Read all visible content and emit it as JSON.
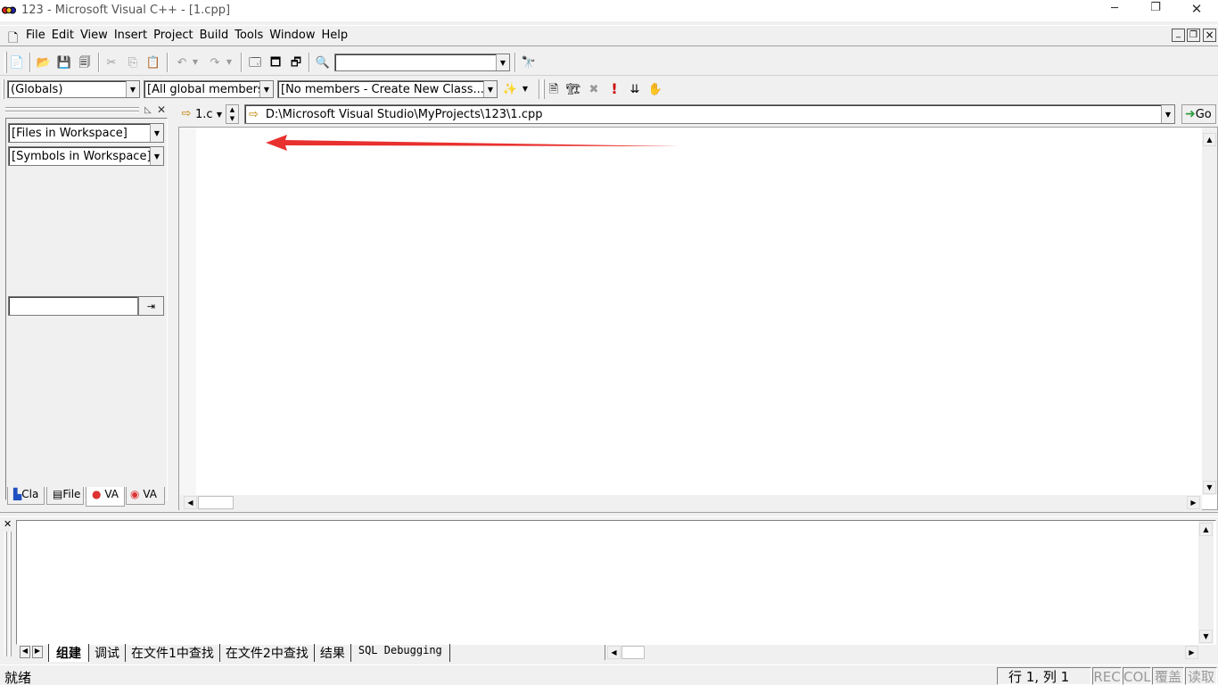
{
  "window": {
    "title": "123 - Microsoft Visual C++ - [1.cpp]",
    "minimize_icon": "minimize-icon",
    "restore_icon": "restore-icon",
    "close_icon": "close-icon"
  },
  "menu": {
    "items": [
      "File",
      "Edit",
      "View",
      "Insert",
      "Project",
      "Build",
      "Tools",
      "Window",
      "Help"
    ],
    "mdi_min": "_",
    "mdi_restore": "❐",
    "mdi_close": "×"
  },
  "toolbar": {
    "find_combo_value": ""
  },
  "wizardbar": {
    "class_combo": "(Globals)",
    "filter_combo": "[All global members",
    "members_combo": "[No members - Create New Class...]"
  },
  "workspace": {
    "files_combo": "[Files in Workspace]",
    "symbols_combo": "[Symbols in Workspace]",
    "search_value": "",
    "tabs": [
      "Cla",
      "File",
      "VA",
      "VA"
    ]
  },
  "navbar": {
    "file_combo": "1.c",
    "path": "D:\\Microsoft Visual Studio\\MyProjects\\123\\1.cpp",
    "go_label": "Go"
  },
  "output": {
    "tabs": [
      "组建",
      "调试",
      "在文件1中查找",
      "在文件2中查找",
      "结果",
      "SQL Debugging"
    ]
  },
  "status": {
    "ready": "就绪",
    "position": "行 1, 列 1",
    "indicators": [
      "REC",
      "COL",
      "覆盖",
      "读取"
    ]
  },
  "colors": {
    "annotation_arrow": "#e8312f",
    "chrome": "#f0f0f0",
    "go_green": "#2e9e3a"
  }
}
